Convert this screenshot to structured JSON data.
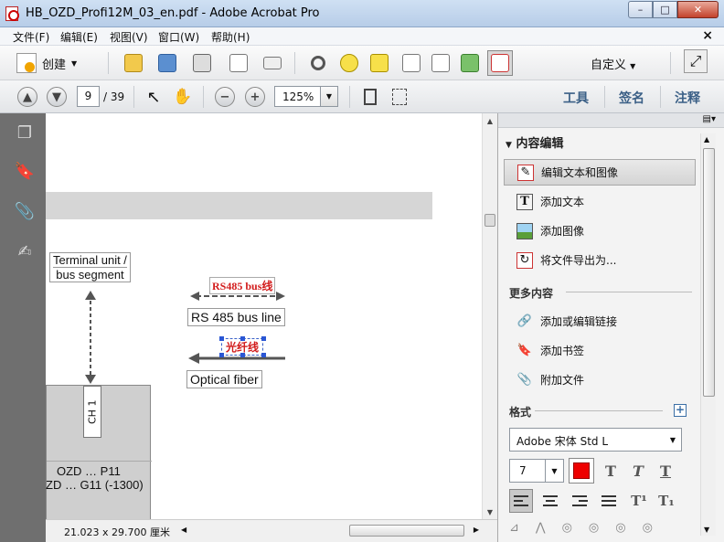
{
  "window": {
    "title": "HB_OZD_Profi12M_03_en.pdf - Adobe Acrobat Pro",
    "min_glyph": "–",
    "max_glyph": "□",
    "close_glyph": "✕"
  },
  "menu": {
    "items": [
      "文件(F)",
      "编辑(E)",
      "视图(V)",
      "窗口(W)",
      "帮助(H)"
    ],
    "close_glyph": "×"
  },
  "toolbar": {
    "create_label": "创建",
    "customize_label": "自定义"
  },
  "nav": {
    "current_page": "9",
    "page_count": "/ 39",
    "zoom": "125%"
  },
  "pane_tabs": [
    "工具",
    "签名",
    "注释"
  ],
  "document": {
    "terminal_line1": "Terminal unit /",
    "terminal_line2": "bus segment",
    "rs485_tag": "RS485 bus线",
    "rs485_label": "RS 485 bus line",
    "fiber_tag": "光纤线",
    "fiber_label": "Optical fiber",
    "channel_label": "CH 1",
    "unit_line1": "OZD … P11",
    "unit_line2": "ZD … G11 (-1300)"
  },
  "status": {
    "page_size": "21.023 x 29.700 厘米"
  },
  "panel": {
    "section_title": "内容编辑",
    "items": [
      {
        "label": "编辑文本和图像",
        "icon": "edit-text-image-icon"
      },
      {
        "label": "添加文本",
        "icon": "add-text-icon"
      },
      {
        "label": "添加图像",
        "icon": "add-image-icon"
      },
      {
        "label": "将文件导出为...",
        "icon": "export-file-icon"
      }
    ],
    "more_title": "更多内容",
    "more_items": [
      {
        "label": "添加或编辑链接",
        "icon": "link-icon"
      },
      {
        "label": "添加书签",
        "icon": "bookmark-icon"
      },
      {
        "label": "附加文件",
        "icon": "paperclip-icon"
      }
    ],
    "format_title": "格式",
    "font_name": "Adobe 宋体 Std L",
    "font_size": "7",
    "font_color": "#ee0000"
  }
}
